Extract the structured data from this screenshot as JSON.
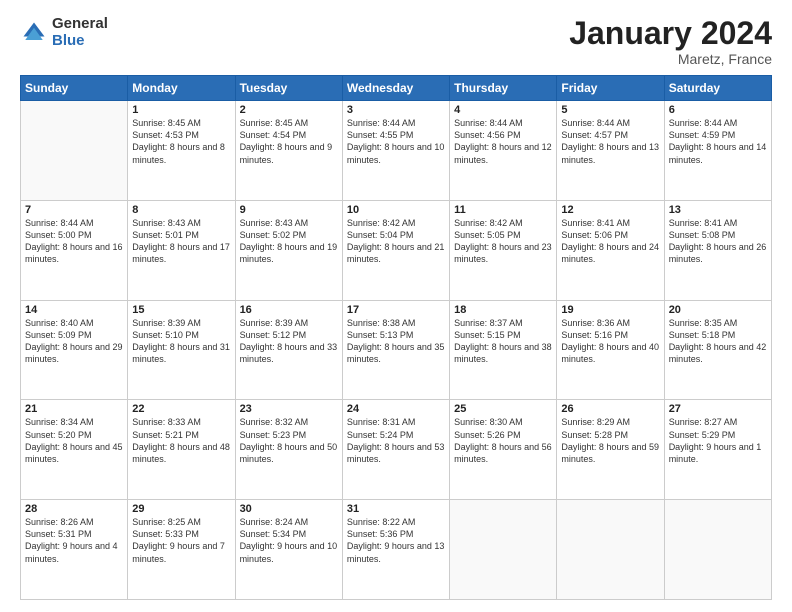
{
  "logo": {
    "general": "General",
    "blue": "Blue"
  },
  "title": "January 2024",
  "location": "Maretz, France",
  "days_header": [
    "Sunday",
    "Monday",
    "Tuesday",
    "Wednesday",
    "Thursday",
    "Friday",
    "Saturday"
  ],
  "weeks": [
    [
      {
        "day": "",
        "sunrise": "",
        "sunset": "",
        "daylight": ""
      },
      {
        "day": "1",
        "sunrise": "Sunrise: 8:45 AM",
        "sunset": "Sunset: 4:53 PM",
        "daylight": "Daylight: 8 hours and 8 minutes."
      },
      {
        "day": "2",
        "sunrise": "Sunrise: 8:45 AM",
        "sunset": "Sunset: 4:54 PM",
        "daylight": "Daylight: 8 hours and 9 minutes."
      },
      {
        "day": "3",
        "sunrise": "Sunrise: 8:44 AM",
        "sunset": "Sunset: 4:55 PM",
        "daylight": "Daylight: 8 hours and 10 minutes."
      },
      {
        "day": "4",
        "sunrise": "Sunrise: 8:44 AM",
        "sunset": "Sunset: 4:56 PM",
        "daylight": "Daylight: 8 hours and 12 minutes."
      },
      {
        "day": "5",
        "sunrise": "Sunrise: 8:44 AM",
        "sunset": "Sunset: 4:57 PM",
        "daylight": "Daylight: 8 hours and 13 minutes."
      },
      {
        "day": "6",
        "sunrise": "Sunrise: 8:44 AM",
        "sunset": "Sunset: 4:59 PM",
        "daylight": "Daylight: 8 hours and 14 minutes."
      }
    ],
    [
      {
        "day": "7",
        "sunrise": "Sunrise: 8:44 AM",
        "sunset": "Sunset: 5:00 PM",
        "daylight": "Daylight: 8 hours and 16 minutes."
      },
      {
        "day": "8",
        "sunrise": "Sunrise: 8:43 AM",
        "sunset": "Sunset: 5:01 PM",
        "daylight": "Daylight: 8 hours and 17 minutes."
      },
      {
        "day": "9",
        "sunrise": "Sunrise: 8:43 AM",
        "sunset": "Sunset: 5:02 PM",
        "daylight": "Daylight: 8 hours and 19 minutes."
      },
      {
        "day": "10",
        "sunrise": "Sunrise: 8:42 AM",
        "sunset": "Sunset: 5:04 PM",
        "daylight": "Daylight: 8 hours and 21 minutes."
      },
      {
        "day": "11",
        "sunrise": "Sunrise: 8:42 AM",
        "sunset": "Sunset: 5:05 PM",
        "daylight": "Daylight: 8 hours and 23 minutes."
      },
      {
        "day": "12",
        "sunrise": "Sunrise: 8:41 AM",
        "sunset": "Sunset: 5:06 PM",
        "daylight": "Daylight: 8 hours and 24 minutes."
      },
      {
        "day": "13",
        "sunrise": "Sunrise: 8:41 AM",
        "sunset": "Sunset: 5:08 PM",
        "daylight": "Daylight: 8 hours and 26 minutes."
      }
    ],
    [
      {
        "day": "14",
        "sunrise": "Sunrise: 8:40 AM",
        "sunset": "Sunset: 5:09 PM",
        "daylight": "Daylight: 8 hours and 29 minutes."
      },
      {
        "day": "15",
        "sunrise": "Sunrise: 8:39 AM",
        "sunset": "Sunset: 5:10 PM",
        "daylight": "Daylight: 8 hours and 31 minutes."
      },
      {
        "day": "16",
        "sunrise": "Sunrise: 8:39 AM",
        "sunset": "Sunset: 5:12 PM",
        "daylight": "Daylight: 8 hours and 33 minutes."
      },
      {
        "day": "17",
        "sunrise": "Sunrise: 8:38 AM",
        "sunset": "Sunset: 5:13 PM",
        "daylight": "Daylight: 8 hours and 35 minutes."
      },
      {
        "day": "18",
        "sunrise": "Sunrise: 8:37 AM",
        "sunset": "Sunset: 5:15 PM",
        "daylight": "Daylight: 8 hours and 38 minutes."
      },
      {
        "day": "19",
        "sunrise": "Sunrise: 8:36 AM",
        "sunset": "Sunset: 5:16 PM",
        "daylight": "Daylight: 8 hours and 40 minutes."
      },
      {
        "day": "20",
        "sunrise": "Sunrise: 8:35 AM",
        "sunset": "Sunset: 5:18 PM",
        "daylight": "Daylight: 8 hours and 42 minutes."
      }
    ],
    [
      {
        "day": "21",
        "sunrise": "Sunrise: 8:34 AM",
        "sunset": "Sunset: 5:20 PM",
        "daylight": "Daylight: 8 hours and 45 minutes."
      },
      {
        "day": "22",
        "sunrise": "Sunrise: 8:33 AM",
        "sunset": "Sunset: 5:21 PM",
        "daylight": "Daylight: 8 hours and 48 minutes."
      },
      {
        "day": "23",
        "sunrise": "Sunrise: 8:32 AM",
        "sunset": "Sunset: 5:23 PM",
        "daylight": "Daylight: 8 hours and 50 minutes."
      },
      {
        "day": "24",
        "sunrise": "Sunrise: 8:31 AM",
        "sunset": "Sunset: 5:24 PM",
        "daylight": "Daylight: 8 hours and 53 minutes."
      },
      {
        "day": "25",
        "sunrise": "Sunrise: 8:30 AM",
        "sunset": "Sunset: 5:26 PM",
        "daylight": "Daylight: 8 hours and 56 minutes."
      },
      {
        "day": "26",
        "sunrise": "Sunrise: 8:29 AM",
        "sunset": "Sunset: 5:28 PM",
        "daylight": "Daylight: 8 hours and 59 minutes."
      },
      {
        "day": "27",
        "sunrise": "Sunrise: 8:27 AM",
        "sunset": "Sunset: 5:29 PM",
        "daylight": "Daylight: 9 hours and 1 minute."
      }
    ],
    [
      {
        "day": "28",
        "sunrise": "Sunrise: 8:26 AM",
        "sunset": "Sunset: 5:31 PM",
        "daylight": "Daylight: 9 hours and 4 minutes."
      },
      {
        "day": "29",
        "sunrise": "Sunrise: 8:25 AM",
        "sunset": "Sunset: 5:33 PM",
        "daylight": "Daylight: 9 hours and 7 minutes."
      },
      {
        "day": "30",
        "sunrise": "Sunrise: 8:24 AM",
        "sunset": "Sunset: 5:34 PM",
        "daylight": "Daylight: 9 hours and 10 minutes."
      },
      {
        "day": "31",
        "sunrise": "Sunrise: 8:22 AM",
        "sunset": "Sunset: 5:36 PM",
        "daylight": "Daylight: 9 hours and 13 minutes."
      },
      {
        "day": "",
        "sunrise": "",
        "sunset": "",
        "daylight": ""
      },
      {
        "day": "",
        "sunrise": "",
        "sunset": "",
        "daylight": ""
      },
      {
        "day": "",
        "sunrise": "",
        "sunset": "",
        "daylight": ""
      }
    ]
  ]
}
